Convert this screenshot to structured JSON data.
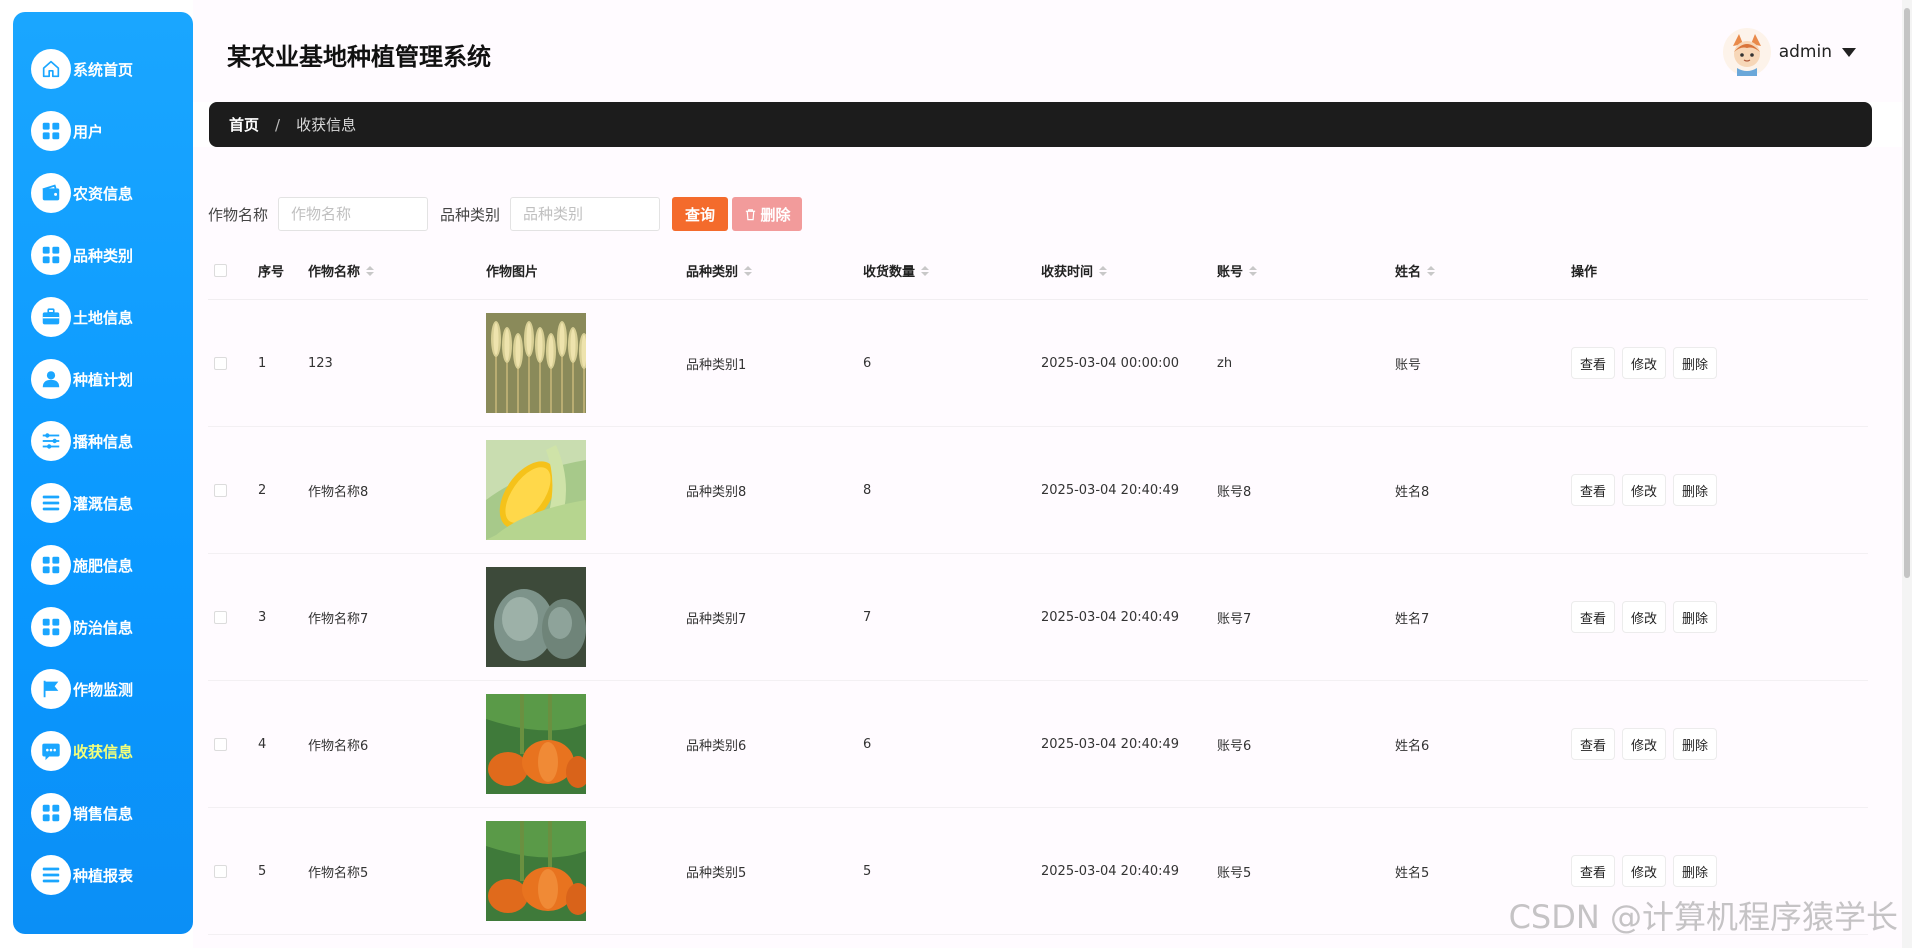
{
  "app": {
    "title": "某农业基地种植管理系统"
  },
  "user": {
    "name": "admin"
  },
  "sidebar": {
    "items": [
      {
        "label": "系统首页",
        "icon": "home-icon"
      },
      {
        "label": "用户",
        "icon": "grid-icon"
      },
      {
        "label": "农资信息",
        "icon": "wallet-icon"
      },
      {
        "label": "品种类别",
        "icon": "grid-icon"
      },
      {
        "label": "土地信息",
        "icon": "briefcase-icon"
      },
      {
        "label": "种植计划",
        "icon": "user-icon"
      },
      {
        "label": "播种信息",
        "icon": "sliders-icon"
      },
      {
        "label": "灌溉信息",
        "icon": "list-icon"
      },
      {
        "label": "施肥信息",
        "icon": "grid-icon"
      },
      {
        "label": "防治信息",
        "icon": "grid-icon"
      },
      {
        "label": "作物监测",
        "icon": "flag-icon"
      },
      {
        "label": "收获信息",
        "icon": "message-icon"
      },
      {
        "label": "销售信息",
        "icon": "grid-icon"
      },
      {
        "label": "种植报表",
        "icon": "list-icon"
      }
    ],
    "active_index": 11
  },
  "breadcrumb": {
    "home": "首页",
    "separator": "/",
    "current": "收获信息"
  },
  "search": {
    "crop_label": "作物名称",
    "crop_placeholder": "作物名称",
    "type_label": "品种类别",
    "type_placeholder": "品种类别",
    "query_button": "查询",
    "delete_button": "删除"
  },
  "table": {
    "headers": {
      "index": "序号",
      "crop_name": "作物名称",
      "crop_image": "作物图片",
      "variety": "品种类别",
      "quantity": "收货数量",
      "time": "收获时间",
      "account": "账号",
      "name": "姓名",
      "actions": "操作"
    },
    "action_labels": {
      "view": "查看",
      "edit": "修改",
      "delete": "删除"
    },
    "rows": [
      {
        "index": "1",
        "crop_name": "123",
        "image": "wheat",
        "variety": "品种类别1",
        "quantity": "6",
        "time": "2025-03-04 00:00:00",
        "account": "zh",
        "name": "账号"
      },
      {
        "index": "2",
        "crop_name": "作物名称8",
        "image": "corn",
        "variety": "品种类别8",
        "quantity": "8",
        "time": "2025-03-04 20:40:49",
        "account": "账号8",
        "name": "姓名8"
      },
      {
        "index": "3",
        "crop_name": "作物名称7",
        "image": "melon",
        "variety": "品种类别7",
        "quantity": "7",
        "time": "2025-03-04 20:40:49",
        "account": "账号7",
        "name": "姓名7"
      },
      {
        "index": "4",
        "crop_name": "作物名称6",
        "image": "pumpkin",
        "variety": "品种类别6",
        "quantity": "6",
        "time": "2025-03-04 20:40:49",
        "account": "账号6",
        "name": "姓名6"
      },
      {
        "index": "5",
        "crop_name": "作物名称5",
        "image": "pumpkin",
        "variety": "品种类别5",
        "quantity": "5",
        "time": "2025-03-04 20:40:49",
        "account": "账号5",
        "name": "姓名5"
      }
    ]
  },
  "watermark": "CSDN @计算机程序猿学长",
  "colors": {
    "sidebar": "#0a98ff",
    "query": "#f46b2c",
    "delete": "#f29b9b",
    "active_label": "#f3ff7a",
    "breadcrumb_bg": "#1c1c1c"
  }
}
